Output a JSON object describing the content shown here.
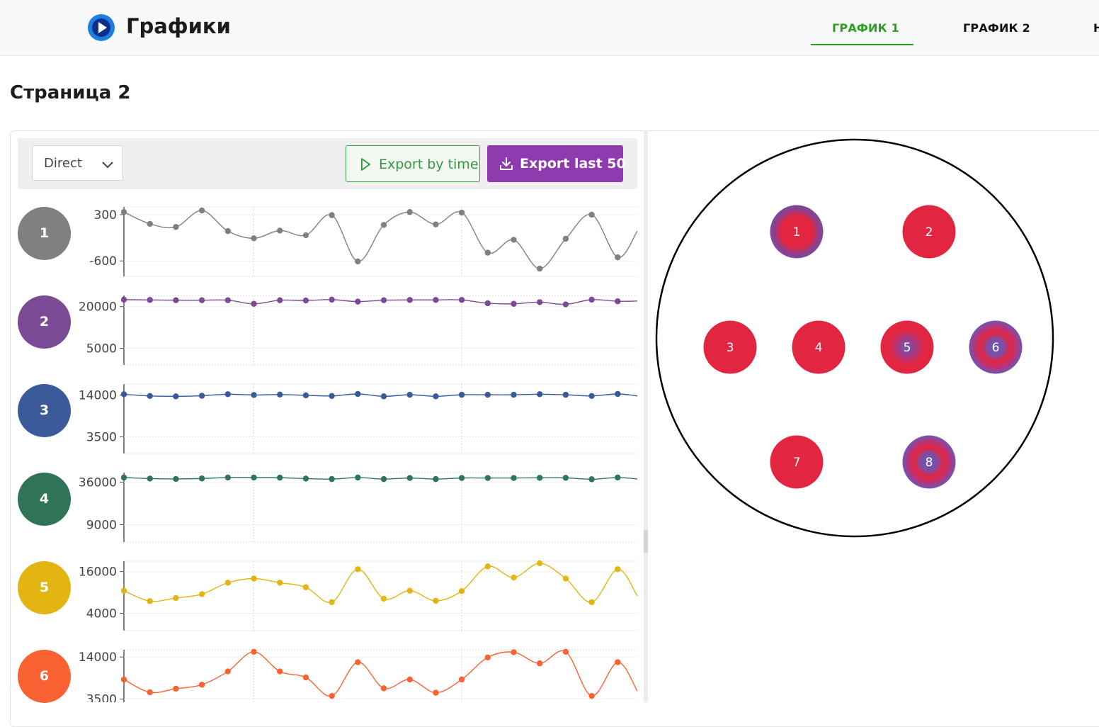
{
  "header": {
    "title": "Графики",
    "tabs": [
      {
        "label": "ГРАФИК 1",
        "active": true
      },
      {
        "label": "ГРАФИК 2",
        "active": false
      },
      {
        "label": "Н",
        "active": false
      }
    ],
    "accent": "#2aa01c"
  },
  "page": {
    "title": "Страница 2"
  },
  "toolbar": {
    "select_value": "Direct",
    "export_time_label": "Export by time",
    "export_last_label": "Export last 50",
    "export_last_color": "#8e3bb0"
  },
  "rows": [
    {
      "label": "1",
      "color": "#808080"
    },
    {
      "label": "2",
      "color": "#7a4b94"
    },
    {
      "label": "3",
      "color": "#3a5a9a"
    },
    {
      "label": "4",
      "color": "#2f7457"
    },
    {
      "label": "5",
      "color": "#e2b513"
    },
    {
      "label": "6",
      "color": "#fa6233"
    }
  ],
  "chart_data": [
    {
      "type": "line",
      "color": "#808080",
      "ticks": [
        "300",
        "-600"
      ],
      "tick_values": [
        300,
        -600
      ],
      "ylim": [
        -900,
        450
      ],
      "values": [
        350,
        120,
        60,
        380,
        -20,
        -160,
        -10,
        -100,
        290,
        -610,
        100,
        350,
        110,
        340,
        -440,
        -190,
        -750,
        -170,
        300,
        -530,
        -20
      ]
    },
    {
      "type": "line",
      "color": "#7a4b94",
      "ticks": [
        "20000",
        "5000"
      ],
      "tick_values": [
        20000,
        5000
      ],
      "ylim": [
        -1000,
        24000
      ],
      "values": [
        22500,
        22400,
        22300,
        22300,
        22300,
        21000,
        22300,
        22200,
        22500,
        21800,
        22300,
        22400,
        22400,
        22400,
        21200,
        21000,
        21600,
        20800,
        22500,
        21900,
        22000
      ]
    },
    {
      "type": "line",
      "color": "#3a5a9a",
      "ticks": [
        "14000",
        "3500"
      ],
      "tick_values": [
        14000,
        3500
      ],
      "ylim": [
        -700,
        16800
      ],
      "values": [
        14220,
        13800,
        13700,
        13850,
        14250,
        14050,
        14150,
        13950,
        13800,
        14300,
        13700,
        14100,
        13700,
        14100,
        14100,
        14100,
        14250,
        14100,
        13800,
        14300,
        13800
      ]
    },
    {
      "type": "line",
      "color": "#2f7457",
      "ticks": [
        "36000",
        "9000"
      ],
      "tick_values": [
        36000,
        9000
      ],
      "ylim": [
        -2000,
        42000
      ],
      "values": [
        38900,
        38200,
        38000,
        38300,
        38900,
        38900,
        38800,
        38200,
        37900,
        38900,
        37900,
        38600,
        37900,
        38600,
        38600,
        38600,
        38700,
        38700,
        37800,
        38900,
        38000
      ]
    },
    {
      "type": "line",
      "color": "#e2b513",
      "ticks": [
        "16000",
        "4000"
      ],
      "tick_values": [
        16000,
        4000
      ],
      "ylim": [
        -1000,
        19000
      ],
      "values": [
        10500,
        7500,
        8400,
        9500,
        12800,
        14000,
        12800,
        11500,
        7200,
        16700,
        8200,
        10500,
        7600,
        10400,
        17500,
        14300,
        18400,
        14000,
        7200,
        16700,
        9000
      ]
    },
    {
      "type": "line",
      "color": "#fa6233",
      "ticks": [
        "14000",
        "3500"
      ],
      "tick_values": [
        14000,
        3500
      ],
      "ylim": [
        -1500,
        15800
      ],
      "values": [
        8400,
        5200,
        6100,
        7100,
        10400,
        15300,
        10400,
        8900,
        4300,
        12700,
        6200,
        8400,
        5100,
        8400,
        13900,
        15200,
        12400,
        15300,
        4300,
        12700,
        5500
      ]
    }
  ],
  "wafer": {
    "sensors": [
      {
        "label": "1",
        "style": "ring"
      },
      {
        "label": "2",
        "style": "solid"
      },
      {
        "label": "3",
        "style": "solid"
      },
      {
        "label": "4",
        "style": "solid"
      },
      {
        "label": "5",
        "style": "core"
      },
      {
        "label": "6",
        "style": "ring-strong"
      },
      {
        "label": "7",
        "style": "solid"
      },
      {
        "label": "8",
        "style": "ring-strong"
      }
    ],
    "sensor_color": "#e22541",
    "glow_color": "#6b57b3"
  }
}
